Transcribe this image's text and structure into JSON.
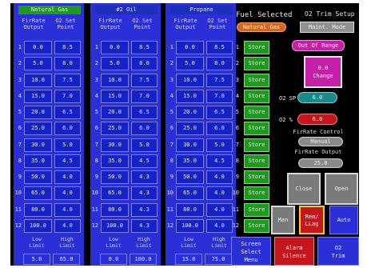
{
  "fuels": [
    {
      "name": "Natural Gas",
      "selected": true,
      "firrate": [
        "0.0",
        "5.0",
        "10.0",
        "15.0",
        "20.0",
        "25.0",
        "30.0",
        "35.0",
        "50.0",
        "65.0",
        "80.0",
        "100.0"
      ],
      "o2": [
        "8.5",
        "8.0",
        "7.5",
        "7.0",
        "6.5",
        "6.0",
        "5.0",
        "4.5",
        "4.0",
        "4.0",
        "4.0",
        "4.0"
      ],
      "low_label": "Low\nLimit",
      "high_label": "High\nLimit",
      "low": "5.0",
      "high": "65.0"
    },
    {
      "name": "#2 Oil",
      "selected": false,
      "firrate": [
        "0.0",
        "5.0",
        "10.0",
        "15.0",
        "20.0",
        "25.0",
        "30.0",
        "35.0",
        "50.0",
        "65.0",
        "80.0",
        "100.0"
      ],
      "o2": [
        "8.5",
        "8.0",
        "7.5",
        "7.0",
        "6.5",
        "6.0",
        "5.0",
        "4.5",
        "4.3",
        "4.3",
        "4.3",
        "4.3"
      ],
      "low_label": "Low\nLimit",
      "high_label": "High\nLimit",
      "low": "0.0",
      "high": "100.0"
    },
    {
      "name": "Propane",
      "selected": false,
      "firrate": [
        "0.0",
        "5.0",
        "10.0",
        "15.0",
        "20.0",
        "25.0",
        "30.0",
        "35.0",
        "50.0",
        "65.0",
        "80.0",
        "100.0"
      ],
      "o2": [
        "8.5",
        "8.0",
        "7.5",
        "7.0",
        "6.5",
        "6.0",
        "5.0",
        "4.5",
        "4.0",
        "4.0",
        "4.0",
        "4.0"
      ],
      "low_label": "Low\nLimit",
      "high_label": "High\nLimit",
      "low": "15.0",
      "high": "75.0"
    }
  ],
  "col_header_fir": "FirRate\nOutput",
  "col_header_o2": "O2 Set\nPoint",
  "rows": [
    "1",
    "2",
    "3",
    "4",
    "5",
    "6",
    "7",
    "8",
    "9",
    "10",
    "11",
    "12"
  ],
  "store_label": "Store",
  "fuel_selected_title": "Fuel Selected",
  "fuel_selected_value": "Natural Gas",
  "title": "O2 Trim Setup",
  "maint_mode": "Maint. Mode",
  "out_of_range": "Out Of Range",
  "change_value": "0.0",
  "change_label": "Change",
  "o2_sp_label": "O2 SP",
  "o2_sp_value": "6.0",
  "o2_pct_label": "O2 %",
  "o2_pct_value": "6.0",
  "firrate_control_label": "FirRate Control",
  "firrate_control_value": "Manual",
  "firrate_output_label": "FirRate Output",
  "firrate_output_value": "25.0",
  "close_label": "Close",
  "open_label": "Open",
  "man_label": "Man",
  "rem_label": "Rem/\nLLag",
  "auto_label": "Auto",
  "screen_select_label": "Screen\nSelect\nMenu",
  "alarm_silence_label": "Alarm\nSilence",
  "o2_trim_label": "O2\nTrim",
  "colors": {
    "blue": "#1422c8",
    "green": "#1f9a1f",
    "red": "#c4161c",
    "magenta": "#c81fa8",
    "teal": "#1b8a8a"
  }
}
